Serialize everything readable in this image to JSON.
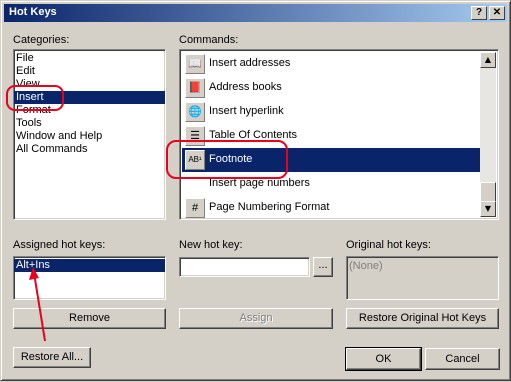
{
  "window": {
    "title": "Hot Keys",
    "help_glyph": "?",
    "close_glyph": "✕"
  },
  "categories": {
    "label": "Categories:",
    "items": [
      "File",
      "Edit",
      "View",
      "Insert",
      "Format",
      "Tools",
      "Window and Help",
      "All Commands"
    ],
    "selected": "Insert"
  },
  "commands": {
    "label": "Commands:",
    "items": [
      {
        "label": "Insert addresses",
        "icon": "address-book-icon",
        "glyph": "📖"
      },
      {
        "label": "Address books",
        "icon": "address-books-icon",
        "glyph": "📕"
      },
      {
        "label": "Insert hyperlink",
        "icon": "hyperlink-icon",
        "glyph": "🌐"
      },
      {
        "label": "Table Of Contents",
        "icon": "table-of-contents-icon",
        "glyph": "☰"
      },
      {
        "label": "Footnote",
        "icon": "footnote-icon",
        "glyph": "AB¹"
      },
      {
        "label": "Insert page numbers",
        "icon": "",
        "glyph": ""
      },
      {
        "label": "Page Numbering Format",
        "icon": "page-numbering-icon",
        "glyph": "#"
      }
    ],
    "selected": "Footnote"
  },
  "assigned": {
    "label": "Assigned hot keys:",
    "items": [
      "Alt+Ins"
    ],
    "selected": "Alt+Ins"
  },
  "new_hotkey": {
    "label": "New hot key:",
    "value": "",
    "browse": "..."
  },
  "original": {
    "label": "Original hot keys:",
    "value": "(None)"
  },
  "buttons": {
    "remove": "Remove",
    "assign": "Assign",
    "restore_original": "Restore Original Hot Keys",
    "restore_all": "Restore All...",
    "ok": "OK",
    "cancel": "Cancel"
  },
  "scrollbar": {
    "up": "▲",
    "down": "▼"
  },
  "colors": {
    "selection": "#0a246a",
    "annotation": "#e8001c",
    "face": "#d4d0c8"
  }
}
